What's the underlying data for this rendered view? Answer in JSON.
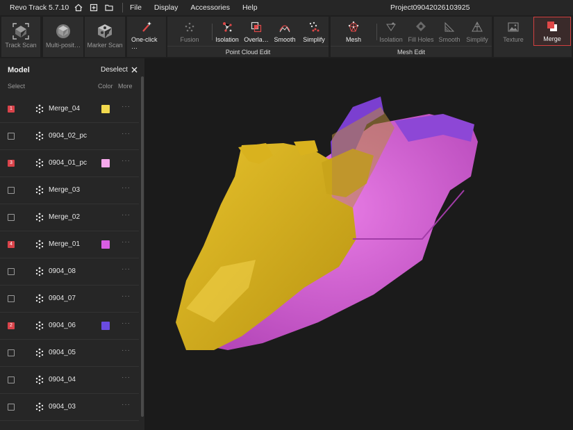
{
  "titlebar": {
    "app_title": "Revo Track 5.7.10",
    "menu": [
      "File",
      "Display",
      "Accessories",
      "Help"
    ],
    "project": "Project09042026103925"
  },
  "ribbon": {
    "scan_buttons": [
      {
        "label": "Track Scan",
        "icon": "track-scan-icon"
      },
      {
        "label": "Multi-posit…",
        "icon": "multi-position-icon"
      },
      {
        "label": "Marker Scan",
        "icon": "marker-scan-icon"
      }
    ],
    "one_click": {
      "label": "One-click …",
      "icon": "wand-icon"
    },
    "point_cloud_edit": {
      "title": "Point Cloud Edit",
      "buttons": [
        {
          "label": "Fusion",
          "icon": "fusion-icon"
        },
        {
          "label": "Isolation",
          "icon": "isolation-icon"
        },
        {
          "label": "Overla…",
          "icon": "overlap-icon"
        },
        {
          "label": "Smooth",
          "icon": "smooth-icon"
        },
        {
          "label": "Simplify",
          "icon": "simplify-icon"
        }
      ]
    },
    "mesh_edit": {
      "title": "Mesh Edit",
      "buttons": [
        {
          "label": "Mesh",
          "icon": "mesh-icon"
        },
        {
          "label": "Isolation",
          "icon": "mesh-isolation-icon"
        },
        {
          "label": "Fill Holes",
          "icon": "fill-holes-icon"
        },
        {
          "label": "Smooth",
          "icon": "mesh-smooth-icon"
        },
        {
          "label": "Simplify",
          "icon": "mesh-simplify-icon"
        }
      ]
    },
    "texture": {
      "label": "Texture",
      "icon": "texture-icon"
    },
    "merge": {
      "label": "Merge",
      "icon": "merge-icon"
    }
  },
  "panel": {
    "title": "Model",
    "deselect_label": "Deselect",
    "col_select": "Select",
    "col_color": "Color",
    "col_more": "More",
    "more_glyph": "···",
    "rows": [
      {
        "order": "1",
        "name": "Merge_04",
        "color": "#f2d94e"
      },
      {
        "order": "",
        "name": "0904_02_pc",
        "color": ""
      },
      {
        "order": "3",
        "name": "0904_01_pc",
        "color": "#f7a8ec"
      },
      {
        "order": "",
        "name": "Merge_03",
        "color": ""
      },
      {
        "order": "",
        "name": "Merge_02",
        "color": ""
      },
      {
        "order": "4",
        "name": "Merge_01",
        "color": "#d95ee3"
      },
      {
        "order": "",
        "name": "0904_08",
        "color": ""
      },
      {
        "order": "",
        "name": "0904_07",
        "color": ""
      },
      {
        "order": "2",
        "name": "0904_06",
        "color": "#6a4be0"
      },
      {
        "order": "",
        "name": "0904_05",
        "color": ""
      },
      {
        "order": "",
        "name": "0904_04",
        "color": ""
      },
      {
        "order": "",
        "name": "0904_03",
        "color": ""
      }
    ]
  },
  "colors": {
    "accent": "#d9434a",
    "yellow_model": "#d9b21e",
    "pink_model": "#d85fd6",
    "purple_model": "#7b3fd0"
  }
}
